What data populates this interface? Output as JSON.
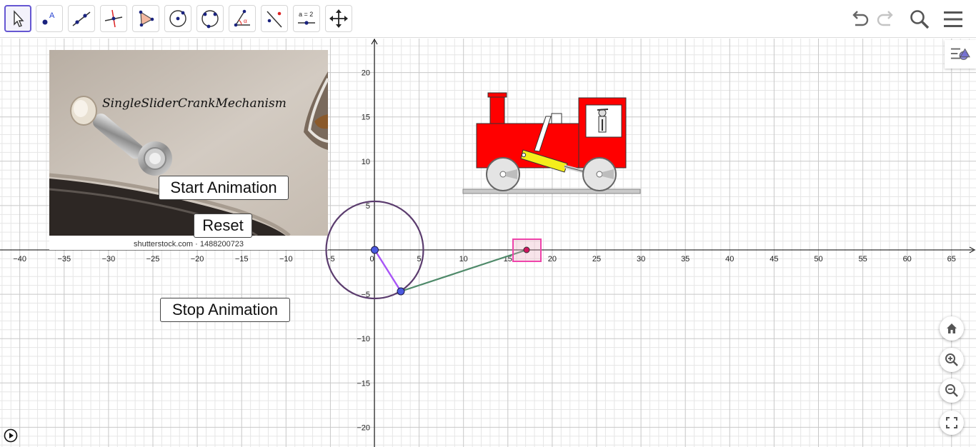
{
  "toolbar": {
    "tools": [
      {
        "name": "move-tool",
        "icon": "arrow-cursor-icon"
      },
      {
        "name": "point-tool",
        "icon": "point-icon"
      },
      {
        "name": "line-tool",
        "icon": "line-icon"
      },
      {
        "name": "perpendicular-line-tool",
        "icon": "perpendicular-icon"
      },
      {
        "name": "polygon-tool",
        "icon": "polygon-icon"
      },
      {
        "name": "circle-center-point-tool",
        "icon": "circle-icon"
      },
      {
        "name": "circle-three-points-tool",
        "icon": "circle-three-points-icon"
      },
      {
        "name": "angle-tool",
        "icon": "angle-icon"
      },
      {
        "name": "reflect-tool",
        "icon": "reflect-icon"
      },
      {
        "name": "slider-tool",
        "icon": "slider-icon"
      },
      {
        "name": "move-graphics-view-tool",
        "icon": "move-arrows-icon"
      }
    ],
    "slider_tool_label": "a = 2",
    "angle_symbol": "α",
    "point_tool_label": "A",
    "right_tools": [
      "undo-icon",
      "redo-icon",
      "search-icon",
      "menu-icon"
    ]
  },
  "graphics": {
    "x_axis_labels": [
      "−40",
      "−35",
      "−30",
      "−25",
      "−20",
      "−15",
      "−10",
      "−5",
      "0",
      "5",
      "10",
      "15",
      "20",
      "25",
      "30",
      "35",
      "40",
      "45",
      "50",
      "55",
      "60",
      "65"
    ],
    "y_axis_labels": [
      "20",
      "15",
      "10",
      "5",
      "−5",
      "−10",
      "−15",
      "−20"
    ],
    "image_title": "SingleSliderCrankMechanism",
    "image_caption": "shutterstock.com · 1488200723"
  },
  "buttons": {
    "start": "Start Animation",
    "reset": "Reset",
    "stop": "Stop Animation"
  },
  "zoom_controls": [
    "home-icon",
    "zoom-in-icon",
    "zoom-out-icon",
    "fullscreen-icon"
  ],
  "colors": {
    "active_tool": "#6557d2",
    "axis": "#000000",
    "grid_major": "#c8c8c8",
    "grid_minor": "#e6e6e6",
    "circle": "#5b3c6e",
    "crank_segment": "#a855f7",
    "connecting_rod": "#4f8a6a",
    "point": "#4c5ae0",
    "slider_point": "#d0155f",
    "slider_box": "#ee44aa",
    "train_body": "#ff0000",
    "piston": "#f5ee1b"
  }
}
